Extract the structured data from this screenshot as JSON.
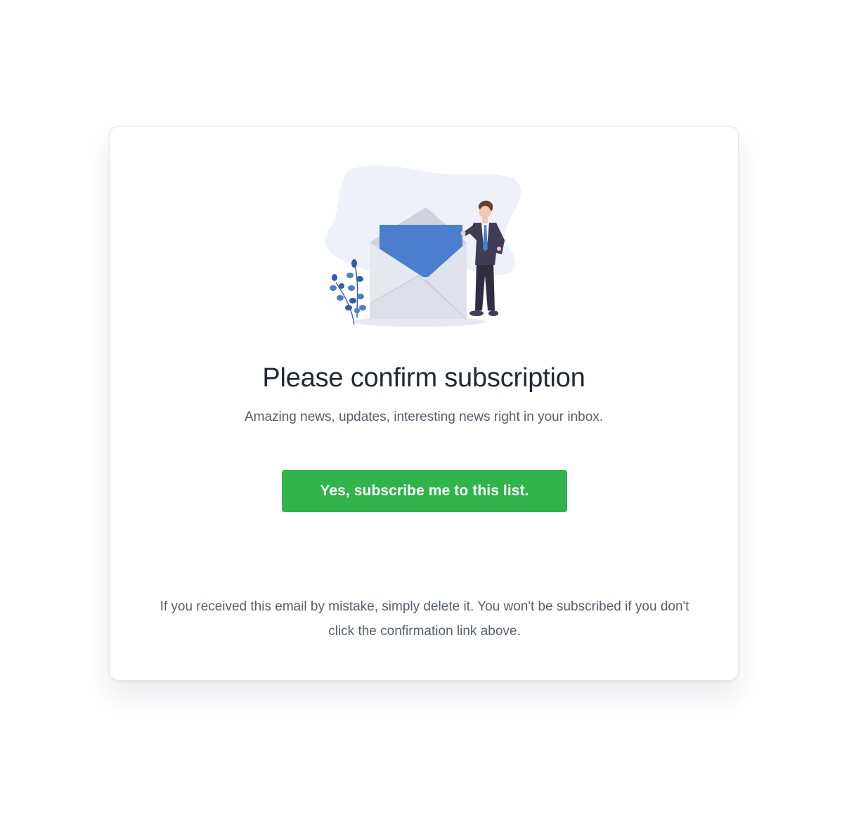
{
  "illustration": {
    "name": "envelope-with-man-illustration",
    "colors": {
      "blob": "#eef1f7",
      "envelope": "#dcdfe9",
      "envelope_shade": "#c9ccd7",
      "letter": "#4a7fd0",
      "suit": "#3f3d56",
      "tie": "#4a7fd0",
      "skin": "#f2c9b5",
      "hair": "#6b3f2a",
      "plant": "#2f5ea8"
    }
  },
  "heading": "Please confirm subscription",
  "subheading": "Amazing news, updates, interesting news right in your inbox.",
  "cta": {
    "label": "Yes, subscribe me to this list.",
    "color": "#30b34a"
  },
  "footer_note": "If you received this email by mistake, simply delete it. You won't be subscribed if you don't click the confirmation link above."
}
